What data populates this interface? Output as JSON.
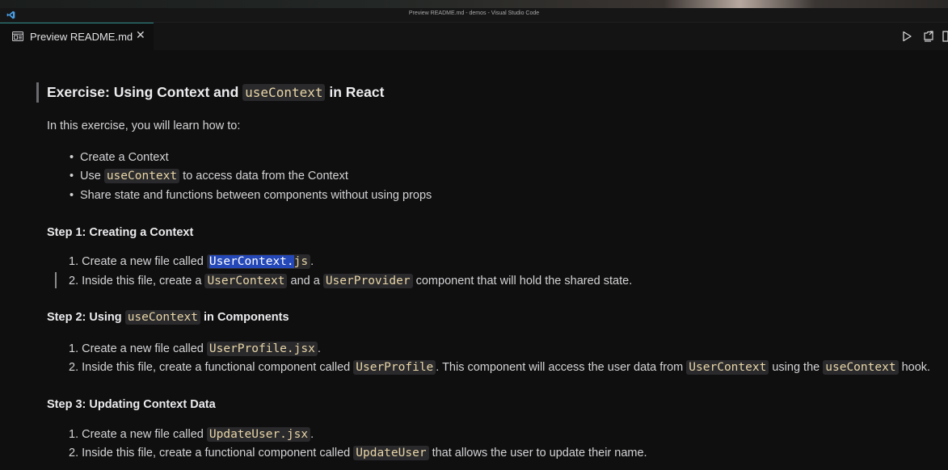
{
  "window": {
    "title": "Preview README.md - demos - Visual Studio Code"
  },
  "tab": {
    "label": "Preview README.md",
    "close_glyph": "✕",
    "icon": "preview-icon"
  },
  "actions": {
    "icons": [
      "run-icon",
      "open-source-icon",
      "split-editor-icon"
    ]
  },
  "doc": {
    "heading": {
      "pre": "Exercise: Using Context and ",
      "code": "useContext",
      "post": " in React"
    },
    "intro": "In this exercise, you will learn how to:",
    "bullets": [
      {
        "text": "Create a Context"
      },
      {
        "pre": "Use ",
        "code": "useContext",
        "post": " to access data from the Context"
      },
      {
        "text": "Share state and functions between components without using props"
      }
    ],
    "step1": {
      "heading": "Step 1: Creating a Context",
      "items": [
        {
          "num": "1.",
          "pre": "Create a new file called ",
          "code_sel": "UserContext.",
          "code_rest": "js",
          "post": "."
        },
        {
          "num": "2.",
          "pre": "Inside this file, create a ",
          "code1": "UserContext",
          "mid": " and a ",
          "code2": "UserProvider",
          "post": " component that will hold the shared state."
        }
      ]
    },
    "step2": {
      "heading_pre": "Step 2: Using ",
      "heading_code": "useContext",
      "heading_post": " in Components",
      "items": [
        {
          "num": "1.",
          "pre": "Create a new file called ",
          "code": "UserProfile.jsx",
          "post": "."
        },
        {
          "num": "2.",
          "pre": "Inside this file, create a functional component called ",
          "code1": "UserProfile",
          "mid1": ". This component will access the user data from ",
          "code2": "UserContext",
          "mid2": " using the ",
          "code3": "useContext",
          "post": " hook."
        }
      ]
    },
    "step3": {
      "heading": "Step 3: Updating Context Data",
      "items": [
        {
          "num": "1.",
          "pre": "Create a new file called ",
          "code": "UpdateUser.jsx",
          "post": "."
        },
        {
          "num": "2.",
          "pre": "Inside this file, create a functional component called ",
          "code": "UpdateUser",
          "post": " that allows the user to update their name."
        }
      ]
    }
  },
  "colors": {
    "background": "#0f0f10",
    "text": "#d4d4d6",
    "code_bg": "#2a2a2c",
    "code_text": "#e9d6a8",
    "selection": "#2448b8",
    "tab_accent": "#2e8a87"
  }
}
